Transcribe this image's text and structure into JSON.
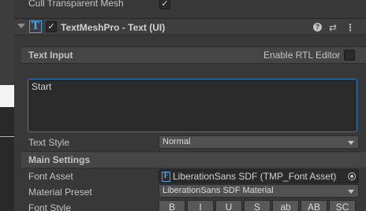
{
  "properties": {
    "cull_transparent_mesh": {
      "label": "Cull Transparent Mesh",
      "checked": true,
      "check_glyph": "✓"
    }
  },
  "component": {
    "title": "TextMeshPro - Text (UI)",
    "icon_glyph": "T",
    "enabled_glyph": "✓",
    "help_glyph": "?",
    "presets_glyph": "⇄",
    "menu_glyph": "⋮"
  },
  "text_input": {
    "section_title": "Text Input",
    "rtl_label": "Enable RTL Editor",
    "text_value": "Start",
    "text_style_label": "Text Style",
    "text_style_value": "Normal"
  },
  "main_settings": {
    "section_title": "Main Settings",
    "font_asset_label": "Font Asset",
    "font_asset_icon_glyph": "F",
    "font_asset_value": "LiberationSans SDF (TMP_Font Asset)",
    "material_preset_label": "Material Preset",
    "material_preset_value": "LiberationSans SDF Material",
    "font_style_label": "Font Style",
    "font_style_buttons": [
      "B",
      "I",
      "U",
      "S",
      "ab",
      "AB",
      "SC"
    ]
  },
  "colors": {
    "accent": "#3a79bb",
    "icon_blue": "#4aa3df",
    "background": "#383838"
  }
}
